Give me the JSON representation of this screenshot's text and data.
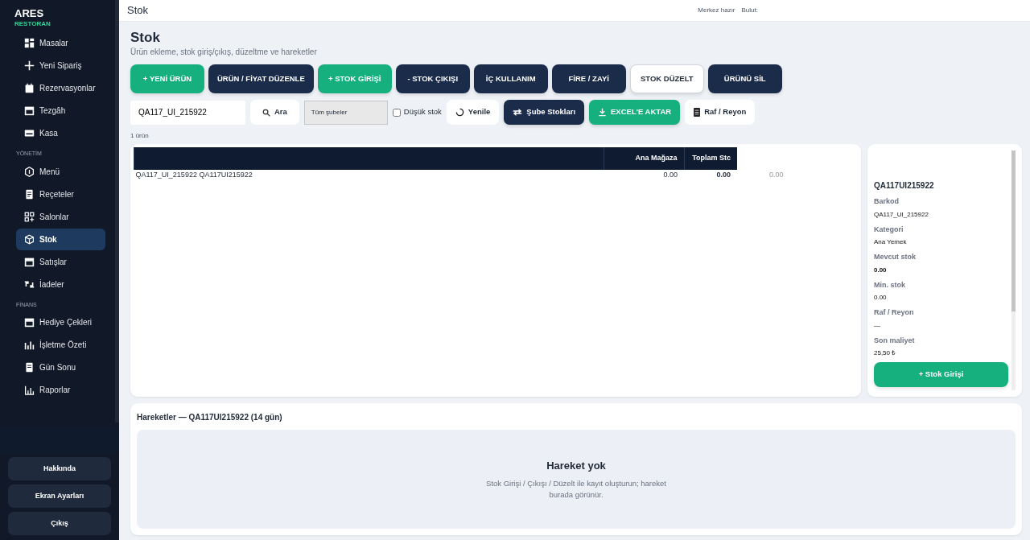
{
  "sidebar": {
    "brand": "ARES",
    "subtitle": "RESTORAN",
    "sections": [
      {
        "items": [
          {
            "label": "Masalar",
            "selected": false
          },
          {
            "label": "Yeni Sipariş",
            "selected": false
          },
          {
            "label": "Rezervasyonlar",
            "selected": false
          },
          {
            "label": "Tezgâh",
            "selected": false
          },
          {
            "label": "Kasa",
            "selected": false
          }
        ]
      },
      {
        "title": "YÖNETİM",
        "items": [
          {
            "label": "Menü",
            "selected": false
          },
          {
            "label": "Reçeteler",
            "selected": false
          },
          {
            "label": "Salonlar",
            "selected": false
          },
          {
            "label": "Stok",
            "selected": true
          },
          {
            "label": "Satışlar",
            "selected": false
          },
          {
            "label": "İadeler",
            "selected": false
          }
        ]
      },
      {
        "title": "FİNANS",
        "items": [
          {
            "label": "Hediye Çekleri",
            "selected": false
          },
          {
            "label": "İşletme Özeti",
            "selected": false
          },
          {
            "label": "Gün Sonu",
            "selected": false
          },
          {
            "label": "Raporlar",
            "selected": false
          }
        ]
      }
    ],
    "buttons": [
      "Hakkında",
      "Ekran Ayarları",
      "Çıkış"
    ]
  },
  "topbar": {
    "title": "Stok",
    "status": [
      "Merkez hazır",
      "Bulut:"
    ]
  },
  "page": {
    "title": "Stok",
    "subtitle": "Ürün ekleme, stok giriş/çıkış, düzeltme ve hareketler"
  },
  "actions": [
    {
      "label": "+ YENİ ÜRÜN",
      "kind": "green"
    },
    {
      "label": "ÜRÜN / FİYAT DÜZENLE",
      "kind": "dark"
    },
    {
      "label": "+ STOK GİRİŞİ",
      "kind": "green"
    },
    {
      "label": "- STOK ÇIKIŞI",
      "kind": "dark"
    },
    {
      "label": "İÇ KULLANIM",
      "kind": "dark"
    },
    {
      "label": "FİRE / ZAYİ",
      "kind": "dark"
    },
    {
      "label": "STOK DÜZELT",
      "kind": "light"
    },
    {
      "label": "ÜRÜNÜ SİL",
      "kind": "dark"
    }
  ],
  "filters": {
    "search": "QA117_UI_215922",
    "search_button": "Ara",
    "branch": "Tüm şubeler",
    "low_stock": {
      "label": "Düşük stok",
      "checked": false
    },
    "buttons": [
      {
        "label": "Yenile",
        "kind": "light"
      },
      {
        "label": "Şube Stokları",
        "kind": "dark"
      },
      {
        "label": "EXCEL'E AKTAR",
        "kind": "green"
      },
      {
        "label": "Raf / Reyon",
        "kind": "light"
      }
    ]
  },
  "count": "1 ürün",
  "table": {
    "columns": [
      "",
      "Ana Mağaza",
      "Toplam Stc",
      ""
    ],
    "rows": [
      {
        "cells": [
          "QA117_UI_215922 QA117UI215922",
          "0.00",
          "0.00",
          "0.00"
        ]
      }
    ]
  },
  "detail": {
    "title": "QA117UI215922",
    "fields": [
      {
        "label": "Barkod",
        "value": "QA117_UI_215922"
      },
      {
        "label": "Kategori",
        "value": "Ana Yemek"
      },
      {
        "label": "Mevcut stok",
        "value": "0.00"
      },
      {
        "label": "Min. stok",
        "value": "0.00"
      },
      {
        "label": "Raf / Reyon",
        "value": "—"
      },
      {
        "label": "Son maliyet",
        "value": "25,50 ₺"
      }
    ],
    "button": "+ Stok Girişi"
  },
  "movements": {
    "title": "Hareketler — QA117UI215922 (14 gün)",
    "empty_title": "Hareket yok",
    "empty_text": "Stok Girişi / Çıkışı / Düzelt ile kayıt oluşturun; hareket burada görünür."
  }
}
